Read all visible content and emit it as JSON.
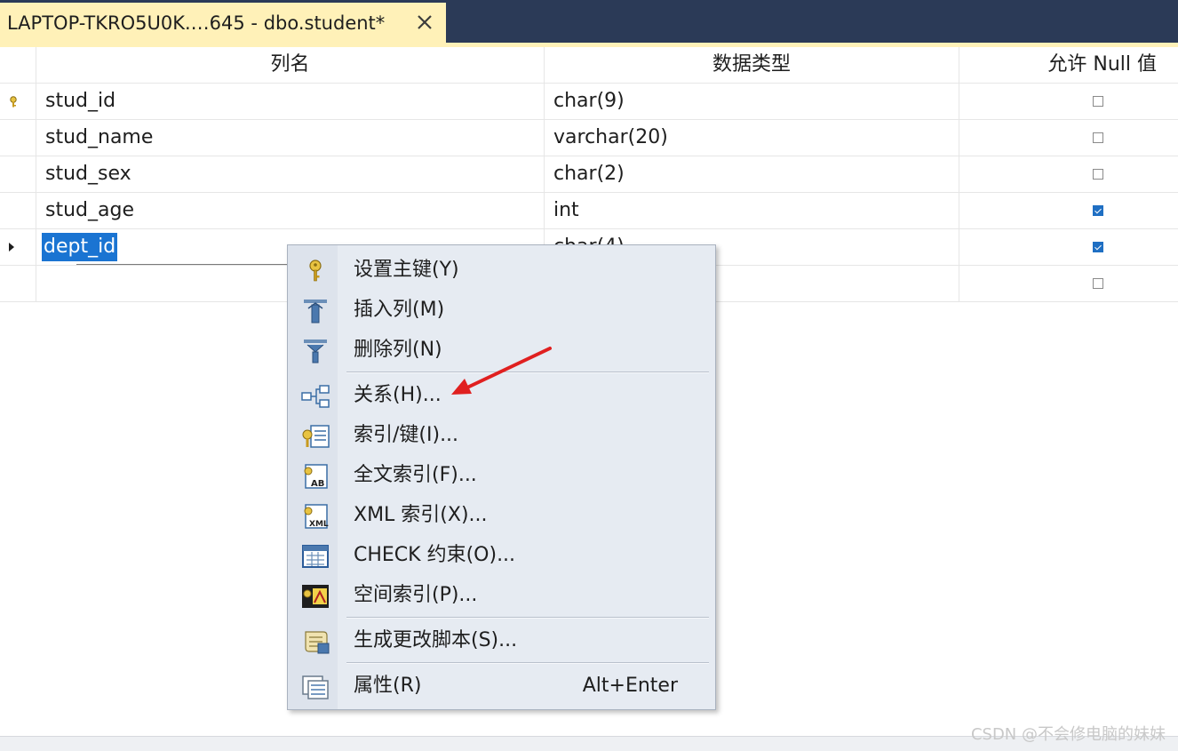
{
  "tab": {
    "title": "LAPTOP-TKRO5U0K.…645 - dbo.student*",
    "close_icon": "close-icon"
  },
  "grid": {
    "columns": [
      "列名",
      "数据类型",
      "允许 Null 值"
    ],
    "rows": [
      {
        "name": "stud_id",
        "type": "char(9)",
        "allow_null": false,
        "marker": "primary-key-icon"
      },
      {
        "name": "stud_name",
        "type": "varchar(20)",
        "allow_null": false,
        "marker": ""
      },
      {
        "name": "stud_sex",
        "type": "char(2)",
        "allow_null": false,
        "marker": ""
      },
      {
        "name": "stud_age",
        "type": "int",
        "allow_null": true,
        "marker": ""
      },
      {
        "name": "dept_id",
        "type": "char(4)",
        "allow_null": true,
        "marker": "current-row-arrow-icon"
      },
      {
        "name": "",
        "type": "",
        "allow_null": false,
        "marker": ""
      }
    ]
  },
  "context_menu": {
    "items": [
      {
        "label": "设置主键(Y)",
        "icon": "key-icon"
      },
      {
        "label": "插入列(M)",
        "icon": "insert-column-icon"
      },
      {
        "label": "删除列(N)",
        "icon": "delete-column-icon"
      },
      {
        "label": "关系(H)...",
        "icon": "relationships-icon"
      },
      {
        "label": "索引/键(I)...",
        "icon": "index-key-icon"
      },
      {
        "label": "全文索引(F)...",
        "icon": "fulltext-index-icon"
      },
      {
        "label": "XML 索引(X)...",
        "icon": "xml-index-icon"
      },
      {
        "label": "CHECK 约束(O)...",
        "icon": "check-constraint-icon"
      },
      {
        "label": "空间索引(P)...",
        "icon": "spatial-index-icon"
      },
      {
        "label": "生成更改脚本(S)...",
        "icon": "generate-script-icon"
      },
      {
        "label": "属性(R)",
        "icon": "properties-icon",
        "shortcut": "Alt+Enter"
      }
    ]
  },
  "watermark": "CSDN @不会修电脑的妹妹",
  "colors": {
    "tab_strip": "#2b3a57",
    "tab_active": "#fff1b8",
    "selection": "#1a74d2",
    "annotation_arrow": "#e02020"
  }
}
